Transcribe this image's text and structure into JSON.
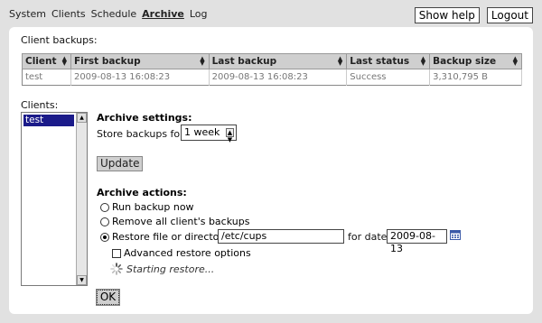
{
  "nav": {
    "items": [
      {
        "label": "System"
      },
      {
        "label": "Clients"
      },
      {
        "label": "Schedule"
      },
      {
        "label": "Archive"
      },
      {
        "label": "Log"
      }
    ],
    "active": "Archive",
    "help_label": "Show help",
    "logout_label": "Logout"
  },
  "client_backups": {
    "title": "Client backups:",
    "columns": [
      "Client",
      "First backup",
      "Last backup",
      "Last status",
      "Backup size"
    ],
    "rows": [
      [
        "test",
        "2009-08-13 16:08:23",
        "2009-08-13 16:08:23",
        "Success",
        "3,310,795 B"
      ]
    ]
  },
  "clients": {
    "title": "Clients:",
    "items": [
      "test"
    ],
    "selected": "test"
  },
  "archive_settings": {
    "title": "Archive settings:",
    "store_label": "Store backups for:",
    "store_value": "1 week",
    "update_label": "Update"
  },
  "archive_actions": {
    "title": "Archive actions:",
    "run_label": "Run backup now",
    "remove_label": "Remove all client's backups",
    "restore_label": "Restore file or directory:",
    "restore_path": "/etc/cups",
    "for_date_label": "for date:",
    "date_value": "2009-08-13",
    "advanced_label": "Advanced restore options",
    "status_text": "Starting restore...",
    "ok_label": "OK"
  }
}
